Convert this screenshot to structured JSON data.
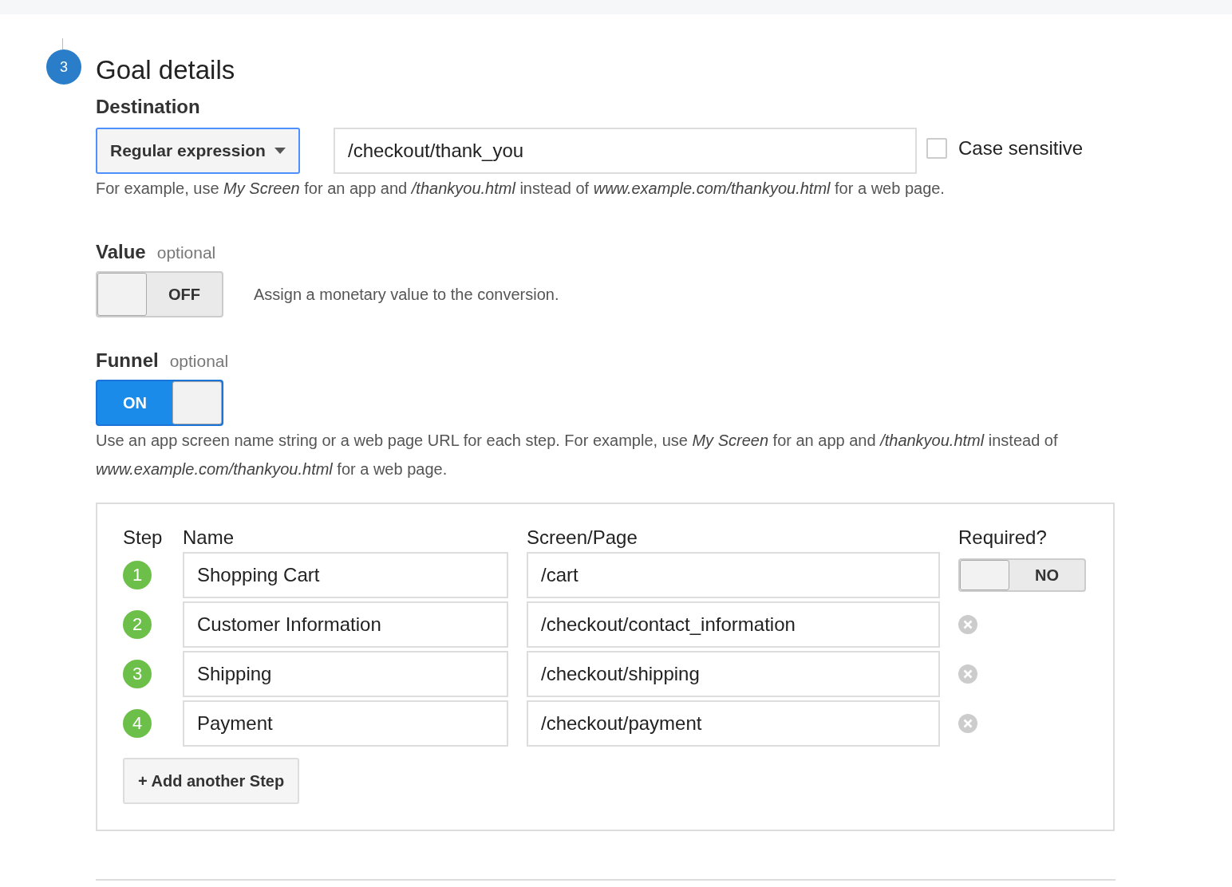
{
  "step_number": "3",
  "title": "Goal details",
  "destination": {
    "label": "Destination",
    "match_type": "Regular expression",
    "value": "/checkout/thank_you",
    "case_sensitive": {
      "label": "Case sensitive",
      "checked": false
    },
    "hint": "For example, use *My Screen* for an app and */thankyou.html* instead of *www.example.com/thankyou.html* for a web page."
  },
  "value": {
    "label": "Value",
    "optional": "optional",
    "toggle": {
      "on": false,
      "label": "OFF"
    },
    "description": "Assign a monetary value to the conversion."
  },
  "funnel": {
    "label": "Funnel",
    "optional": "optional",
    "toggle": {
      "on": true,
      "label": "ON"
    },
    "description": "Use an app screen name string or a web page URL for each step. For example, use *My Screen* for an app and */thankyou.html* instead of *www.example.com/thankyou.html* for a web page.",
    "columns": [
      "Step",
      "Name",
      "Screen/Page",
      "Required?"
    ],
    "steps": [
      {
        "number": "1",
        "name": "Shopping Cart",
        "page": "/cart",
        "action": {
          "kind": "toggle",
          "on": false,
          "label": "NO"
        }
      },
      {
        "number": "2",
        "name": "Customer Information",
        "page": "/checkout/contact_information",
        "action": {
          "kind": "remove"
        }
      },
      {
        "number": "3",
        "name": "Shipping",
        "page": "/checkout/shipping",
        "action": {
          "kind": "remove"
        }
      },
      {
        "number": "4",
        "name": "Payment",
        "page": "/checkout/payment",
        "action": {
          "kind": "remove"
        }
      }
    ],
    "add_button": "+ Add another Step"
  }
}
